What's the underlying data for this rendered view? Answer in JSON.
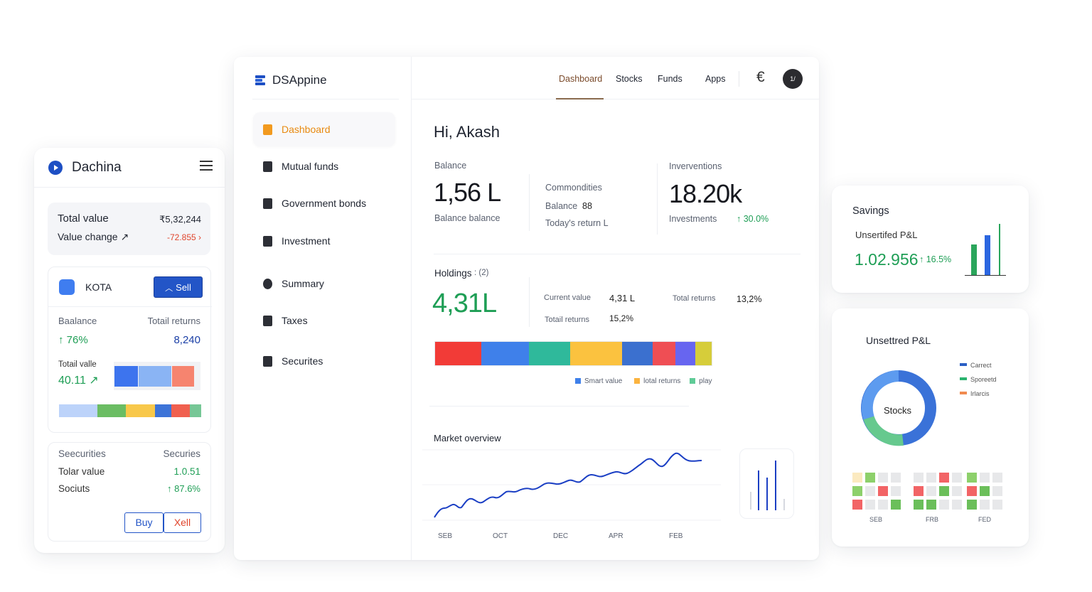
{
  "mobile": {
    "title": "Dachina",
    "total_value_label": "Total value",
    "total_value": "₹5,32,244",
    "value_change_label": "Value change ↗",
    "value_change": "-72.855 ›",
    "kota": {
      "name": "KOTA",
      "sell_label": "Sell",
      "col1_header": "Baalance",
      "col2_header": "Totail returns",
      "balance_change": "↑ 76%",
      "total_returns": "8,240",
      "total_value_label": "Totail valle",
      "total_value": "40.11 ↗"
    },
    "securities": {
      "col1_header": "Seecurities",
      "col2_header": "Securies",
      "rows": [
        {
          "label": "Tolar value",
          "value": "1.0.51"
        },
        {
          "label": "Sociuts",
          "value": "↑ 87.6%"
        }
      ],
      "buy_label": "Buy",
      "sell_label": "Xell"
    }
  },
  "app": {
    "brand": "DSAppine",
    "sidebar": [
      {
        "label": "Dashboard",
        "active": true
      },
      {
        "label": "Mutual funds"
      },
      {
        "label": "Government bonds"
      },
      {
        "label": "Investment"
      },
      {
        "label": "Summary"
      },
      {
        "label": "Taxes"
      },
      {
        "label": "Securites"
      }
    ],
    "tabs": [
      "Dashboard",
      "Stocks",
      "Funds",
      "Apps"
    ],
    "currency_symbol": "€",
    "avatar_text": "1/"
  },
  "dashboard": {
    "greeting": "Hi, Akash",
    "balance": {
      "label": "Balance",
      "value": "1,56 L",
      "sub": "Balance balance"
    },
    "commodities": {
      "title": "Commondities",
      "balance_label": "Balance",
      "balance_value": "88",
      "return_label": "Today's return L"
    },
    "interventions": {
      "title": "Inverventions",
      "value": "18.20k",
      "sub": "Investments",
      "change": "↑ 30.0%"
    },
    "holdings": {
      "title": "Holdings",
      "count": ": (2)",
      "value": "4,31L",
      "current_value_label": "Current value",
      "current_value": "4,31 L",
      "total_returns_label_1": "Total returns",
      "total_returns_1": "13,2%",
      "total_returns_label_2": "Totail returns",
      "total_returns_2": "15,2%",
      "legend": [
        "Smart value",
        "lotal returns",
        "play"
      ]
    },
    "market": {
      "title": "Market overview",
      "x_labels": [
        "SEB",
        "OCT",
        "DEC",
        "APR",
        "FEB"
      ]
    }
  },
  "savings": {
    "title": "Savings",
    "sub": "Unsertifed P&L",
    "value": "1.02.956",
    "change": "↑ 16.5%"
  },
  "pl": {
    "title": "Unsettred P&L",
    "donut_label": "Stocks",
    "legend": [
      "Carrect",
      "Sporeetd",
      "Irlarcis"
    ],
    "heatmap_labels": [
      "SEB",
      "FRB",
      "FED"
    ]
  },
  "colors": {
    "accent_orange": "#e88a10",
    "brand_blue": "#1d4fc4",
    "positive_green": "#1e9e55",
    "negative_red": "#e0452c",
    "line_blue": "#1b3fc4"
  }
}
